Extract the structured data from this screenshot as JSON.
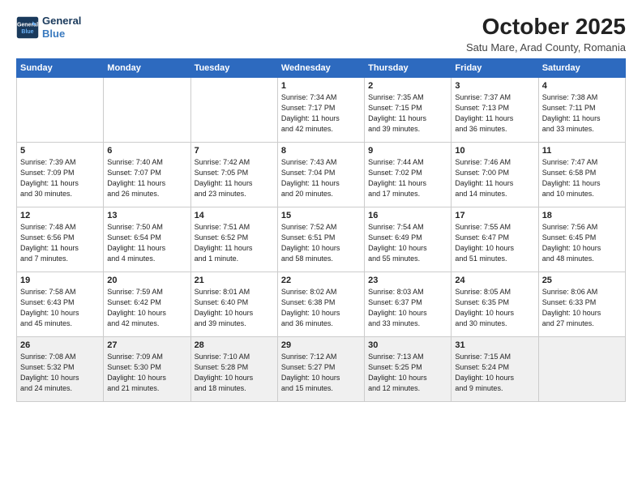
{
  "header": {
    "logo_line1": "General",
    "logo_line2": "Blue",
    "month": "October 2025",
    "location": "Satu Mare, Arad County, Romania"
  },
  "weekdays": [
    "Sunday",
    "Monday",
    "Tuesday",
    "Wednesday",
    "Thursday",
    "Friday",
    "Saturday"
  ],
  "weeks": [
    [
      {
        "day": "",
        "info": ""
      },
      {
        "day": "",
        "info": ""
      },
      {
        "day": "",
        "info": ""
      },
      {
        "day": "1",
        "info": "Sunrise: 7:34 AM\nSunset: 7:17 PM\nDaylight: 11 hours\nand 42 minutes."
      },
      {
        "day": "2",
        "info": "Sunrise: 7:35 AM\nSunset: 7:15 PM\nDaylight: 11 hours\nand 39 minutes."
      },
      {
        "day": "3",
        "info": "Sunrise: 7:37 AM\nSunset: 7:13 PM\nDaylight: 11 hours\nand 36 minutes."
      },
      {
        "day": "4",
        "info": "Sunrise: 7:38 AM\nSunset: 7:11 PM\nDaylight: 11 hours\nand 33 minutes."
      }
    ],
    [
      {
        "day": "5",
        "info": "Sunrise: 7:39 AM\nSunset: 7:09 PM\nDaylight: 11 hours\nand 30 minutes."
      },
      {
        "day": "6",
        "info": "Sunrise: 7:40 AM\nSunset: 7:07 PM\nDaylight: 11 hours\nand 26 minutes."
      },
      {
        "day": "7",
        "info": "Sunrise: 7:42 AM\nSunset: 7:05 PM\nDaylight: 11 hours\nand 23 minutes."
      },
      {
        "day": "8",
        "info": "Sunrise: 7:43 AM\nSunset: 7:04 PM\nDaylight: 11 hours\nand 20 minutes."
      },
      {
        "day": "9",
        "info": "Sunrise: 7:44 AM\nSunset: 7:02 PM\nDaylight: 11 hours\nand 17 minutes."
      },
      {
        "day": "10",
        "info": "Sunrise: 7:46 AM\nSunset: 7:00 PM\nDaylight: 11 hours\nand 14 minutes."
      },
      {
        "day": "11",
        "info": "Sunrise: 7:47 AM\nSunset: 6:58 PM\nDaylight: 11 hours\nand 10 minutes."
      }
    ],
    [
      {
        "day": "12",
        "info": "Sunrise: 7:48 AM\nSunset: 6:56 PM\nDaylight: 11 hours\nand 7 minutes."
      },
      {
        "day": "13",
        "info": "Sunrise: 7:50 AM\nSunset: 6:54 PM\nDaylight: 11 hours\nand 4 minutes."
      },
      {
        "day": "14",
        "info": "Sunrise: 7:51 AM\nSunset: 6:52 PM\nDaylight: 11 hours\nand 1 minute."
      },
      {
        "day": "15",
        "info": "Sunrise: 7:52 AM\nSunset: 6:51 PM\nDaylight: 10 hours\nand 58 minutes."
      },
      {
        "day": "16",
        "info": "Sunrise: 7:54 AM\nSunset: 6:49 PM\nDaylight: 10 hours\nand 55 minutes."
      },
      {
        "day": "17",
        "info": "Sunrise: 7:55 AM\nSunset: 6:47 PM\nDaylight: 10 hours\nand 51 minutes."
      },
      {
        "day": "18",
        "info": "Sunrise: 7:56 AM\nSunset: 6:45 PM\nDaylight: 10 hours\nand 48 minutes."
      }
    ],
    [
      {
        "day": "19",
        "info": "Sunrise: 7:58 AM\nSunset: 6:43 PM\nDaylight: 10 hours\nand 45 minutes."
      },
      {
        "day": "20",
        "info": "Sunrise: 7:59 AM\nSunset: 6:42 PM\nDaylight: 10 hours\nand 42 minutes."
      },
      {
        "day": "21",
        "info": "Sunrise: 8:01 AM\nSunset: 6:40 PM\nDaylight: 10 hours\nand 39 minutes."
      },
      {
        "day": "22",
        "info": "Sunrise: 8:02 AM\nSunset: 6:38 PM\nDaylight: 10 hours\nand 36 minutes."
      },
      {
        "day": "23",
        "info": "Sunrise: 8:03 AM\nSunset: 6:37 PM\nDaylight: 10 hours\nand 33 minutes."
      },
      {
        "day": "24",
        "info": "Sunrise: 8:05 AM\nSunset: 6:35 PM\nDaylight: 10 hours\nand 30 minutes."
      },
      {
        "day": "25",
        "info": "Sunrise: 8:06 AM\nSunset: 6:33 PM\nDaylight: 10 hours\nand 27 minutes."
      }
    ],
    [
      {
        "day": "26",
        "info": "Sunrise: 7:08 AM\nSunset: 5:32 PM\nDaylight: 10 hours\nand 24 minutes."
      },
      {
        "day": "27",
        "info": "Sunrise: 7:09 AM\nSunset: 5:30 PM\nDaylight: 10 hours\nand 21 minutes."
      },
      {
        "day": "28",
        "info": "Sunrise: 7:10 AM\nSunset: 5:28 PM\nDaylight: 10 hours\nand 18 minutes."
      },
      {
        "day": "29",
        "info": "Sunrise: 7:12 AM\nSunset: 5:27 PM\nDaylight: 10 hours\nand 15 minutes."
      },
      {
        "day": "30",
        "info": "Sunrise: 7:13 AM\nSunset: 5:25 PM\nDaylight: 10 hours\nand 12 minutes."
      },
      {
        "day": "31",
        "info": "Sunrise: 7:15 AM\nSunset: 5:24 PM\nDaylight: 10 hours\nand 9 minutes."
      },
      {
        "day": "",
        "info": ""
      }
    ]
  ]
}
